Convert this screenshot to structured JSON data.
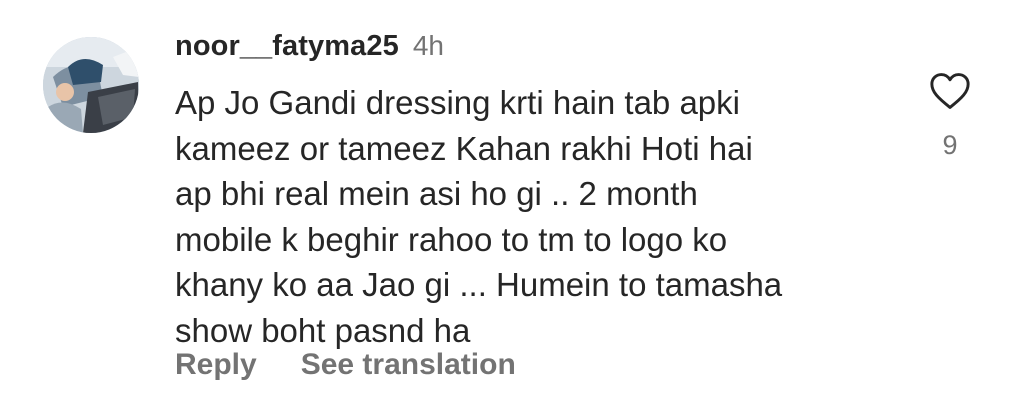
{
  "comment": {
    "username": "noor__fatyma25",
    "time": "4h",
    "text": "Ap Jo Gandi dressing krti hain tab apki\nkameez or tameez Kahan rakhi Hoti hai\nap bhi real mein asi ho gi .. 2 month\nmobile k beghir rahoo to tm to logo ko\nkhany ko aa Jao gi ... Humein to tamasha\nshow boht pasnd ha",
    "like_count": "9",
    "actions": {
      "reply_label": "Reply",
      "see_translation_label": "See translation"
    }
  },
  "icons": {
    "like": "heart-icon"
  },
  "colors": {
    "text": "#262626",
    "secondary": "#737373",
    "background": "#ffffff"
  }
}
